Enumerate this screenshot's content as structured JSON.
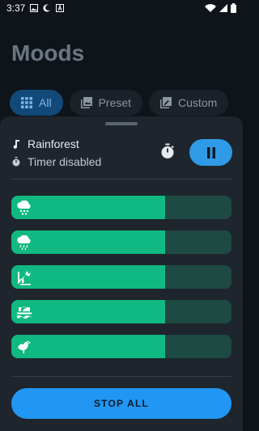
{
  "status_bar": {
    "time": "3:37",
    "left_icons": [
      "image-icon",
      "moon-icon",
      "a-icon"
    ],
    "right_icons": [
      "wifi-icon",
      "signal-icon",
      "battery-icon"
    ]
  },
  "page_title": "Moods",
  "chips": [
    {
      "label": "All",
      "icon": "grid-icon",
      "selected": true
    },
    {
      "label": "Preset",
      "icon": "preset-icon",
      "selected": false
    },
    {
      "label": "Custom",
      "icon": "custom-icon",
      "selected": false
    }
  ],
  "now_playing": {
    "name": "Rainforest",
    "name_icon": "music-note-icon",
    "timer_status": "Timer disabled",
    "timer_icon": "timer-icon"
  },
  "controls": {
    "timer_button_icon": "stopwatch-icon",
    "pause_button_icon": "pause-icon"
  },
  "tracks": [
    {
      "icon": "rain-cloud-icon",
      "level": 0.7
    },
    {
      "icon": "heavy-rain-icon",
      "level": 0.7
    },
    {
      "icon": "jungle-icon",
      "level": 0.7
    },
    {
      "icon": "waves-icon",
      "level": 0.7
    },
    {
      "icon": "bird-icon",
      "level": 0.7
    }
  ],
  "stop_all_label": "STOP ALL",
  "colors": {
    "background": "#0f141a",
    "sheet": "#1e252d",
    "accent_blue": "#2196f3",
    "track_fill": "#10b981",
    "track_rest": "#1e4a44"
  }
}
